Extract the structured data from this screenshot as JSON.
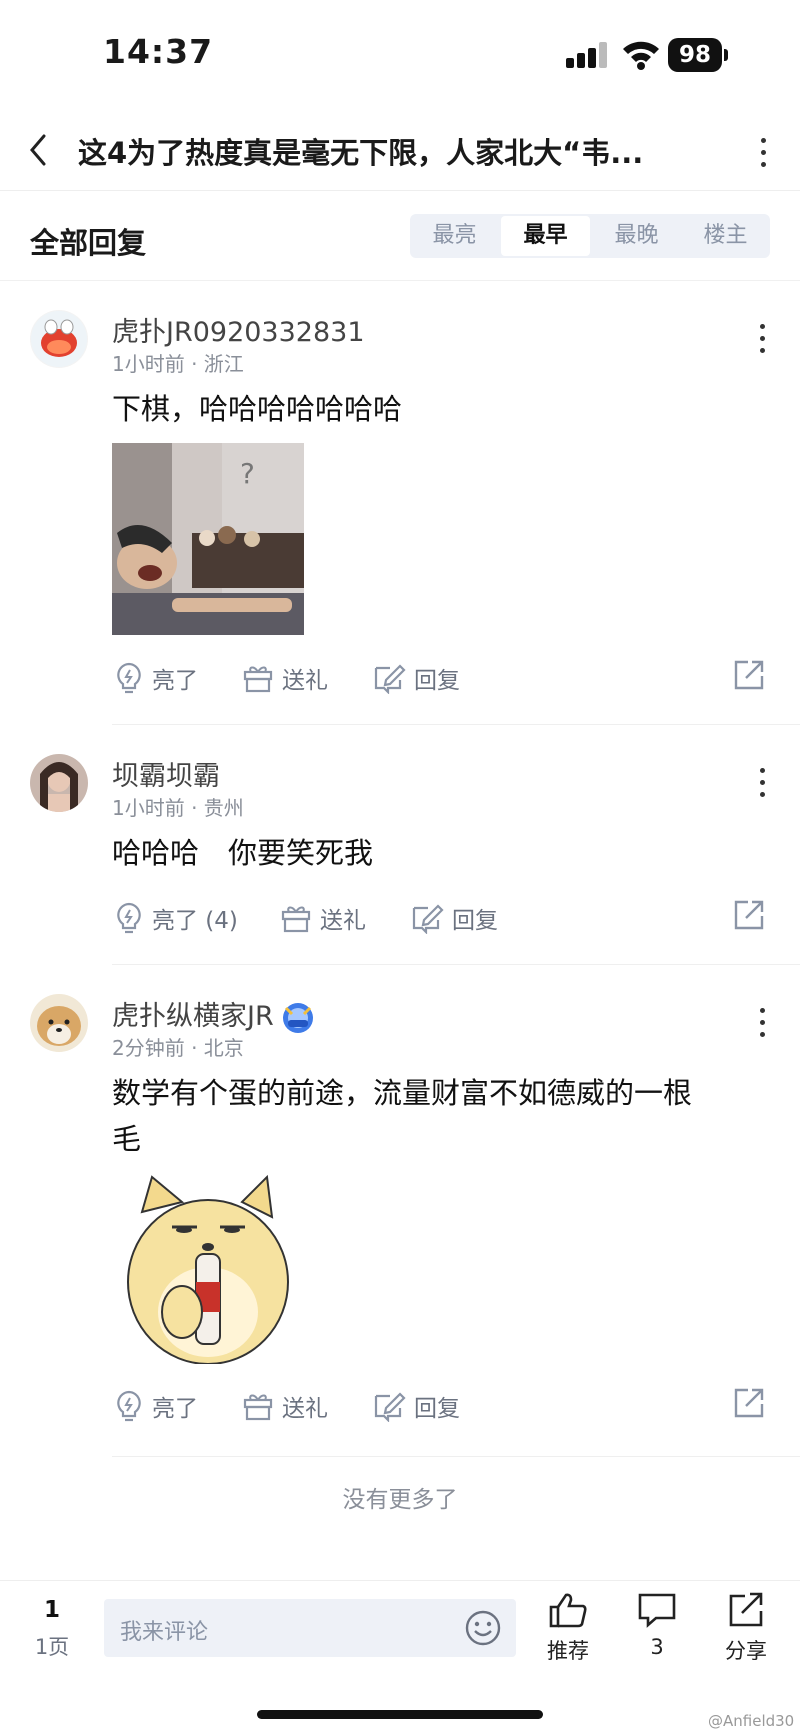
{
  "status_bar": {
    "time": "14:37",
    "battery": "98"
  },
  "nav": {
    "title": "这4为了热度真是毫无下限，人家北大“韦..."
  },
  "replies_header": {
    "title": "全部回复",
    "sort_tabs": [
      "最亮",
      "最早",
      "最晚",
      "楼主"
    ],
    "active_tab": "最早"
  },
  "comments": [
    {
      "username": "虎扑JR0920332831",
      "meta": "1小时前 · 浙江",
      "text": "下棋，哈哈哈哈哈哈哈",
      "has_image": true,
      "actions": {
        "like": "亮了",
        "gift": "送礼",
        "reply": "回复"
      }
    },
    {
      "username": "坝霸坝霸",
      "meta": "1小时前 · 贵州",
      "text": "哈哈哈　你要笑死我",
      "has_image": false,
      "actions": {
        "like": "亮了 (4)",
        "gift": "送礼",
        "reply": "回复"
      }
    },
    {
      "username": "虎扑纵横家JR",
      "meta": "2分钟前 · 北京",
      "text_line1": "数学有个蛋的前途，流量财富不如德威的一根",
      "text_line2": "毛",
      "has_image": true,
      "actions": {
        "like": "亮了",
        "gift": "送礼",
        "reply": "回复"
      }
    }
  ],
  "no_more": "没有更多了",
  "bottom_bar": {
    "page_number": "1",
    "page_label": "1页",
    "input_placeholder": "我来评论",
    "recommend_label": "推荐",
    "comment_count": "3",
    "share_label": "分享"
  },
  "watermark": "@Anfield30",
  "colors": {
    "muted": "#8a8f99",
    "tab_bg": "#eef1f7",
    "text": "#111111"
  }
}
